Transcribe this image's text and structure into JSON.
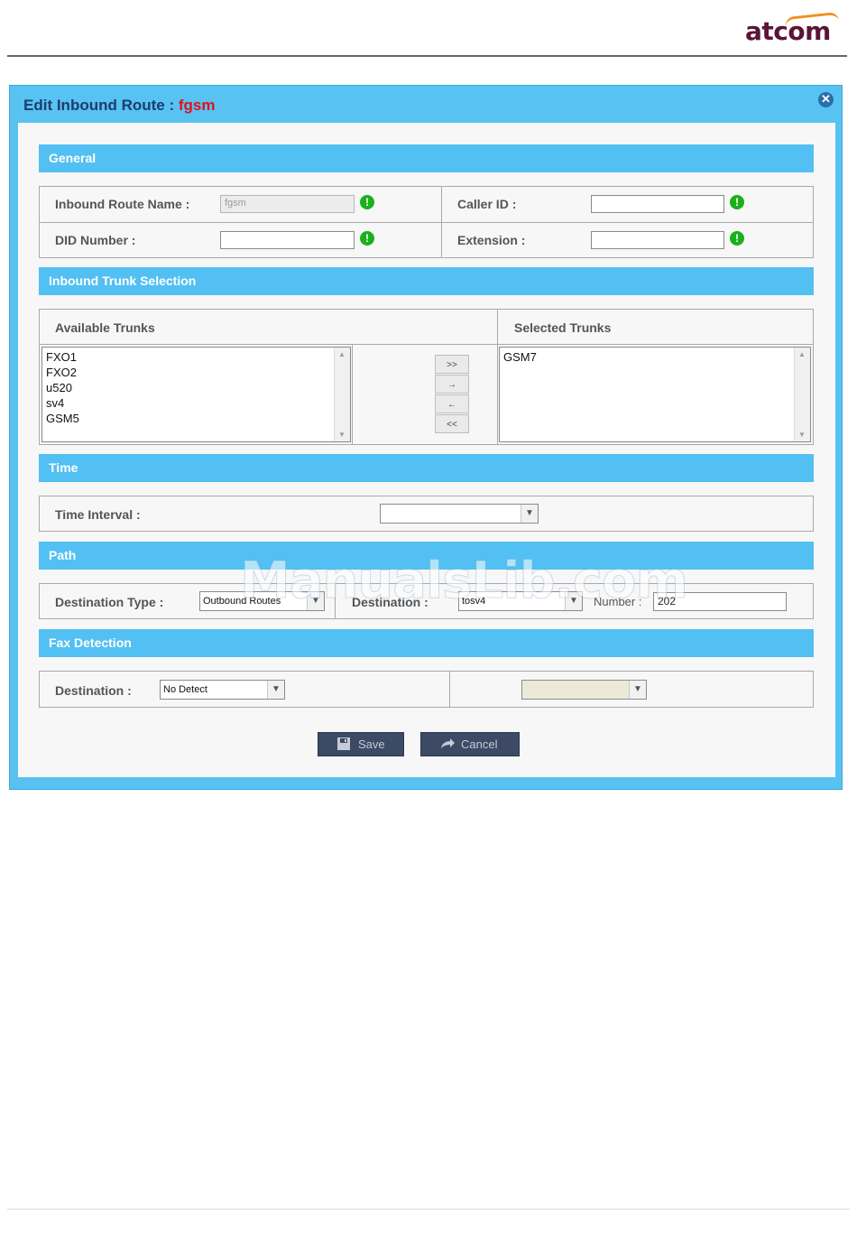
{
  "header": {
    "brand": "atcom"
  },
  "dialog": {
    "title_prefix": "Edit Inbound Route : ",
    "route_name": "fgsm",
    "close_glyph": "✕"
  },
  "general": {
    "title": "General",
    "inbound_route_name_label": "Inbound Route Name :",
    "inbound_route_name_value": "fgsm",
    "caller_id_label": "Caller ID :",
    "caller_id_value": "",
    "did_number_label": "DID Number :",
    "did_number_value": "",
    "extension_label": "Extension :",
    "extension_value": "",
    "warning_glyph": "!"
  },
  "trunks": {
    "title": "Inbound Trunk Selection",
    "available_label": "Available Trunks",
    "selected_label": "Selected Trunks",
    "available": [
      "FXO1",
      "FXO2",
      "u520",
      "sv4",
      "GSM5"
    ],
    "selected": [
      "GSM7"
    ],
    "buttons": {
      "add_all": ">>",
      "add": "→",
      "remove": "←",
      "remove_all": "<<"
    }
  },
  "time": {
    "title": "Time",
    "interval_label": "Time Interval :",
    "interval_value": ""
  },
  "path": {
    "title": "Path",
    "destination_type_label": "Destination Type :",
    "destination_type_value": "Outbound Routes",
    "destination_label": "Destination :",
    "destination_value": "tosv4",
    "number_label": "Number :",
    "number_value": "202"
  },
  "fax": {
    "title": "Fax Detection",
    "destination_label": "Destination :",
    "destination_value": "No Detect",
    "secondary_value": ""
  },
  "actions": {
    "save": "Save",
    "cancel": "Cancel"
  },
  "watermark": "ManualsLib.com",
  "colors": {
    "dialog_blue": "#58c2f2",
    "section_blue": "#52c0f2",
    "title_red": "#e0121a",
    "warning_green": "#1bb01b",
    "button_navy": "#3c4a66"
  }
}
